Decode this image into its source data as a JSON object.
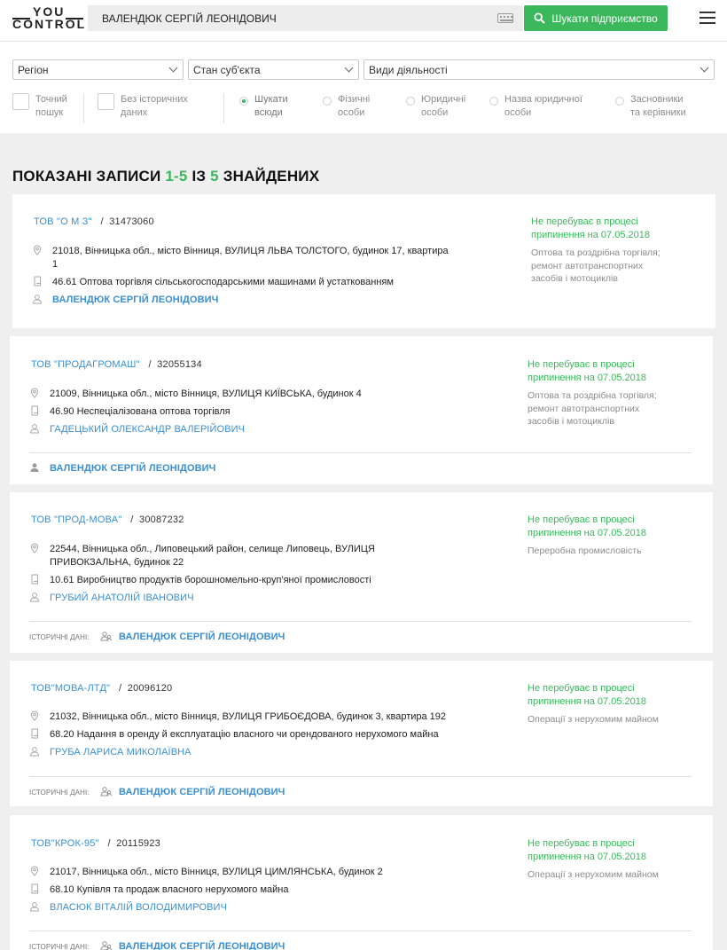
{
  "logo": {
    "line1": "YOU",
    "line2": "CONTROL"
  },
  "search": {
    "value": "ВАЛЕНДЮК СЕРГІЙ ЛЕОНІДОВИЧ",
    "button_label": "Шукати підприємство"
  },
  "filters": {
    "region": "Регіон",
    "state": "Стан суб'єкта",
    "activity": "Види діяльності",
    "exact_1": "Точний",
    "exact_2": "пошук",
    "hist_1": "Без історичних",
    "hist_2": "даних",
    "r1_1": "Шукати",
    "r1_2": "всюди",
    "r2_1": "Фізичні",
    "r2_2": "особи",
    "r3_1": "Юридичні",
    "r3_2": "особи",
    "r4_1": "Назва юридичної",
    "r4_2": "особи",
    "r5_1": "Засновники",
    "r5_2": "та керівники"
  },
  "results": {
    "prefix": "ПОКАЗАНІ ЗАПИСИ",
    "range": "1-5",
    "of": "ІЗ",
    "total": "5",
    "suffix": "ЗНАЙДЕНИХ"
  },
  "history_label": "ІСТОРИЧНІ ДАНІ:",
  "cards": [
    {
      "name": "ТОВ \"О М З\"",
      "code": "31473060",
      "address_1": "21018, Вінницька обл., місто Вінниця, ВУЛИЦЯ ЛЬВА ТОЛСТОГО, будинок 17, квартира",
      "address_2": "1",
      "kved": "46.61 Оптова торгівля сільськогосподарськими машинами й устаткованням",
      "person": "ВАЛЕНДЮК СЕРГІЙ ЛЕОНІДОВИЧ",
      "status_1": "Не перебуває в процесі",
      "status_2": "припинення на 07.05.2018",
      "activity_1": "Оптова та роздрібна торгівля;",
      "activity_2": "ремонт автотранспортних",
      "activity_3": "засобів і мотоциклів"
    },
    {
      "name": "ТОВ \"ПРОДАГРОМАШ\"",
      "code": "32055134",
      "address_1": "21009, Вінницька обл., місто Вінниця, ВУЛИЦЯ КИЇВСЬКА, будинок 4",
      "kved": "46.90 Неспеціалізована оптова торгівля",
      "person": "ГАДЕЦЬКИЙ ОЛЕКСАНДР ВАЛЕРІЙОВИЧ",
      "person_2": "ВАЛЕНДЮК СЕРГІЙ ЛЕОНІДОВИЧ",
      "status_1": "Не перебуває в процесі",
      "status_2": "припинення на 07.05.2018",
      "activity_1": "Оптова та роздрібна торгівля;",
      "activity_2": "ремонт автотранспортних",
      "activity_3": "засобів і мотоциклів"
    },
    {
      "name": "ТОВ \"ПРОД-МОВА\"",
      "code": "30087232",
      "address_1": "22544, Вінницька обл., Липовецький район, селище Липовець, ВУЛИЦЯ",
      "address_2": "ПРИВОКЗАЛЬНА, будинок 22",
      "kved": "10.61 Виробництво продуктів борошномельно-круп'яної промисловості",
      "person": "ГРУБИЙ АНАТОЛІЙ ІВАНОВИЧ",
      "hist_person": "ВАЛЕНДЮК СЕРГІЙ ЛЕОНІДОВИЧ",
      "status_1": "Не перебуває в процесі",
      "status_2": "припинення на 07.05.2018",
      "activity_1": "Переробна промисловість"
    },
    {
      "name": "ТОВ\"МОВА-ЛТД\"",
      "code": "20096120",
      "address_1": "21032, Вінницька обл., місто Вінниця, ВУЛИЦЯ ГРИБОЄДОВА, будинок 3, квартира 192",
      "kved": "68.20 Надання в оренду й експлуатацію власного чи орендованого нерухомого майна",
      "person": "ГРУБА ЛАРИСА МИКОЛАЇВНА",
      "hist_person": "ВАЛЕНДЮК СЕРГІЙ ЛЕОНІДОВИЧ",
      "status_1": "Не перебуває в процесі",
      "status_2": "припинення на 07.05.2018",
      "activity_1": "Операції з нерухомим майном"
    },
    {
      "name": "ТОВ\"КРОК-95\"",
      "code": "20115923",
      "address_1": "21017, Вінницька обл., місто Вінниця, ВУЛИЦЯ ЦИМЛЯНСЬКА, будинок 2",
      "kved": "68.10 Купівля та продаж власного нерухомого майна",
      "person": "ВЛАСЮК ВІТАЛІЙ ВОЛОДИМИРОВИЧ",
      "hist_person": "ВАЛЕНДЮК СЕРГІЙ ЛЕОНІДОВИЧ",
      "status_1": "Не перебуває в процесі",
      "status_2": "припинення на 07.05.2018",
      "activity_1": "Операції з нерухомим майном"
    }
  ]
}
